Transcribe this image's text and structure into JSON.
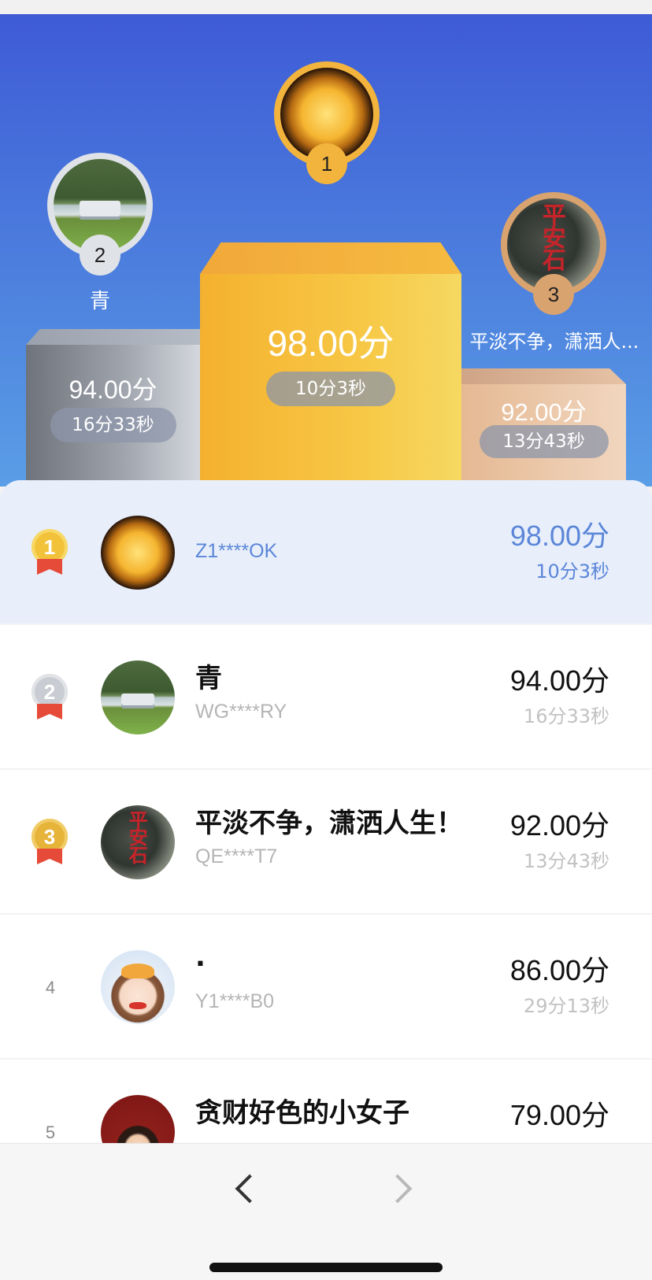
{
  "podium": {
    "first": {
      "rank": "1",
      "name": "",
      "score": "98.00分",
      "time": "10分3秒"
    },
    "second": {
      "rank": "2",
      "name": "青",
      "score": "94.00分",
      "time": "16分33秒"
    },
    "third": {
      "rank": "3",
      "name": "平淡不争，潇洒人...",
      "score": "92.00分",
      "time": "13分43秒"
    }
  },
  "rows": [
    {
      "rank": "1",
      "name": "",
      "id": "Z1****OK",
      "score": "98.00分",
      "time": "10分3秒",
      "avatar": "sun-avatar"
    },
    {
      "rank": "2",
      "name": "青",
      "id": "WG****RY",
      "score": "94.00分",
      "time": "16分33秒",
      "avatar": "camper-scenery-avatar"
    },
    {
      "rank": "3",
      "name": "平淡不争，潇洒人生！",
      "id": "QE****T7",
      "score": "92.00分",
      "time": "13分43秒",
      "avatar": "peace-stone-avatar"
    },
    {
      "rank": "4",
      "name": ".",
      "id": "Y1****B0",
      "score": "86.00分",
      "time": "29分13秒",
      "avatar": "cartoon-girl-avatar"
    },
    {
      "rank": "5",
      "name": "贪财好色的小女子",
      "id": "",
      "score": "79.00分",
      "time": "",
      "avatar": "mouse-avatar"
    }
  ],
  "nav": {
    "prev_icon": "chevron-left-icon",
    "next_icon": "chevron-right-icon"
  },
  "colors": {
    "hero_gradient_top": "#3e5bd6",
    "gold": "#f4b12f",
    "silver": "#9ea3ac",
    "bronze": "#e5b993",
    "highlight_text": "#5b86d8",
    "highlight_row": "#e8effb"
  }
}
